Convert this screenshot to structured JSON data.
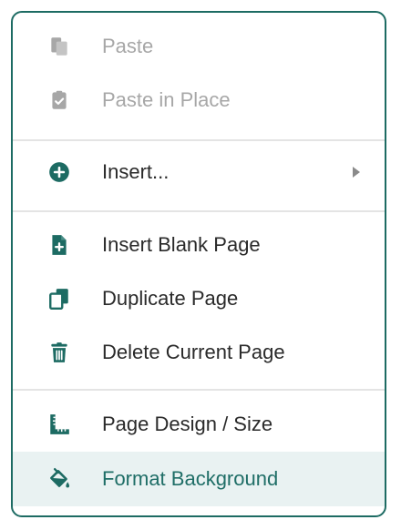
{
  "colors": {
    "accent": "#1d6b63",
    "disabled": "#a7a7a7",
    "text": "#2a2a2a",
    "highlight_bg": "#e9f2f2"
  },
  "menu": {
    "items": [
      {
        "label": "Paste",
        "icon": "paste-icon",
        "disabled": true
      },
      {
        "label": "Paste in Place",
        "icon": "paste-in-place-icon",
        "disabled": true
      },
      {
        "label": "Insert...",
        "icon": "plus-circle-icon",
        "has_submenu": true
      },
      {
        "label": "Insert Blank Page",
        "icon": "add-page-icon"
      },
      {
        "label": "Duplicate Page",
        "icon": "duplicate-icon"
      },
      {
        "label": "Delete Current Page",
        "icon": "trash-icon"
      },
      {
        "label": "Page Design / Size",
        "icon": "ruler-icon"
      },
      {
        "label": "Format Background",
        "icon": "paint-bucket-icon",
        "highlighted": true
      }
    ]
  }
}
